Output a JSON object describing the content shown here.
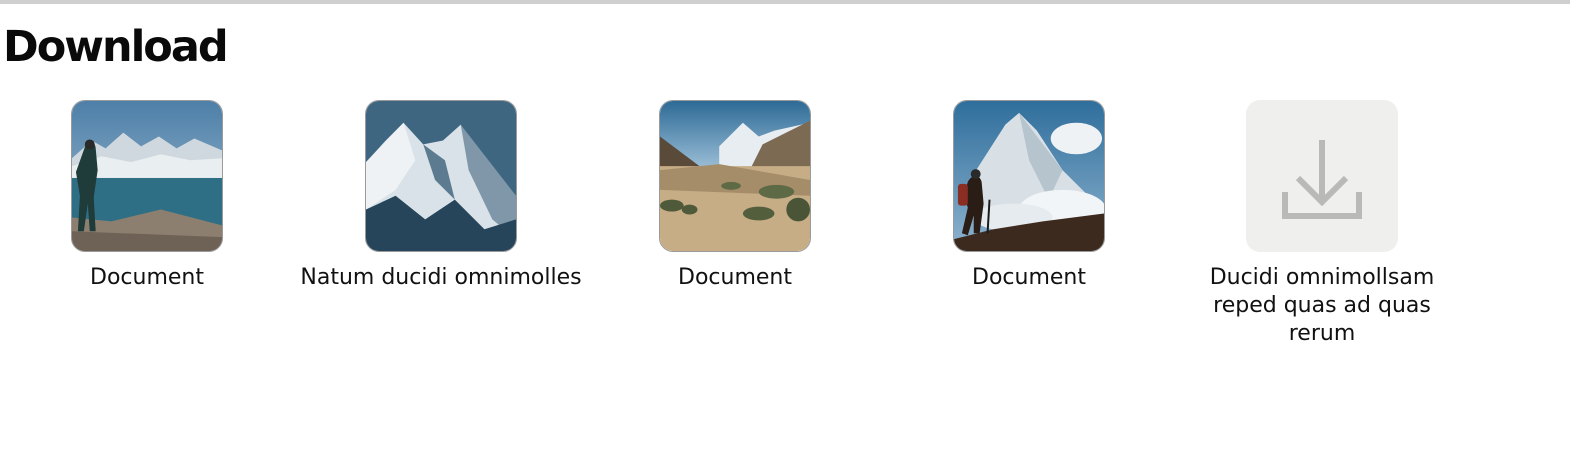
{
  "page": {
    "title": "Download"
  },
  "downloads": {
    "items": [
      {
        "label": "Document",
        "thumbnail": "photo-hiker-by-lake"
      },
      {
        "label": "Natum ducidi omnimolles",
        "thumbnail": "photo-mountain-peaks"
      },
      {
        "label": "Document",
        "thumbnail": "photo-valley-plain"
      },
      {
        "label": "Document",
        "thumbnail": "photo-hiker-on-ridge"
      },
      {
        "label": "Ducidi omnimollsam reped quas ad quas rerum",
        "thumbnail": "download-icon"
      }
    ]
  },
  "colors": {
    "placeholder_bg": "#efefed",
    "icon_gray": "#b9b9b7",
    "title_text": "#0a0a0a"
  }
}
